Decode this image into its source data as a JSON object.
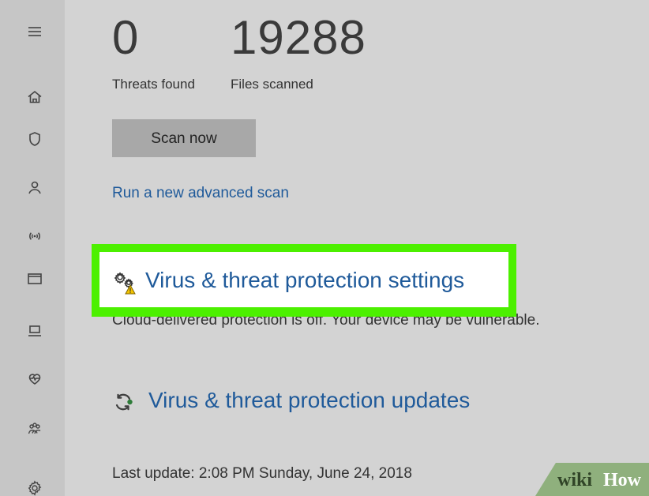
{
  "sidebar": {
    "icons": [
      "hamburger-menu-icon",
      "home-icon",
      "shield-icon",
      "person-icon",
      "wireless-icon",
      "browser-window-icon",
      "laptop-icon",
      "heart-health-icon",
      "family-icon",
      "settings-gear-icon"
    ]
  },
  "summary": {
    "threats_found": {
      "value": "0",
      "label": "Threats found"
    },
    "files_scanned": {
      "value": "19288",
      "label": "Files scanned"
    }
  },
  "actions": {
    "scan_now": "Scan now",
    "advanced_scan": "Run a new advanced scan"
  },
  "settings_section": {
    "title": "Virus & threat protection settings",
    "subtitle": "Cloud-delivered protection is off. Your device may be vulnerable.",
    "icon": "settings-warning-icon"
  },
  "updates_section": {
    "title": "Virus & threat protection updates",
    "icon": "refresh-update-icon"
  },
  "last_update": "Last update: 2:08 PM Sunday, June 24, 2018",
  "watermark": {
    "wiki": "wiki",
    "how": "How"
  },
  "colors": {
    "background": "#d3d3d3",
    "sidebar": "#c6c6c6",
    "link": "#1f5a9a",
    "highlight": "#4cf000",
    "scan_button": "#a8a8a8"
  }
}
